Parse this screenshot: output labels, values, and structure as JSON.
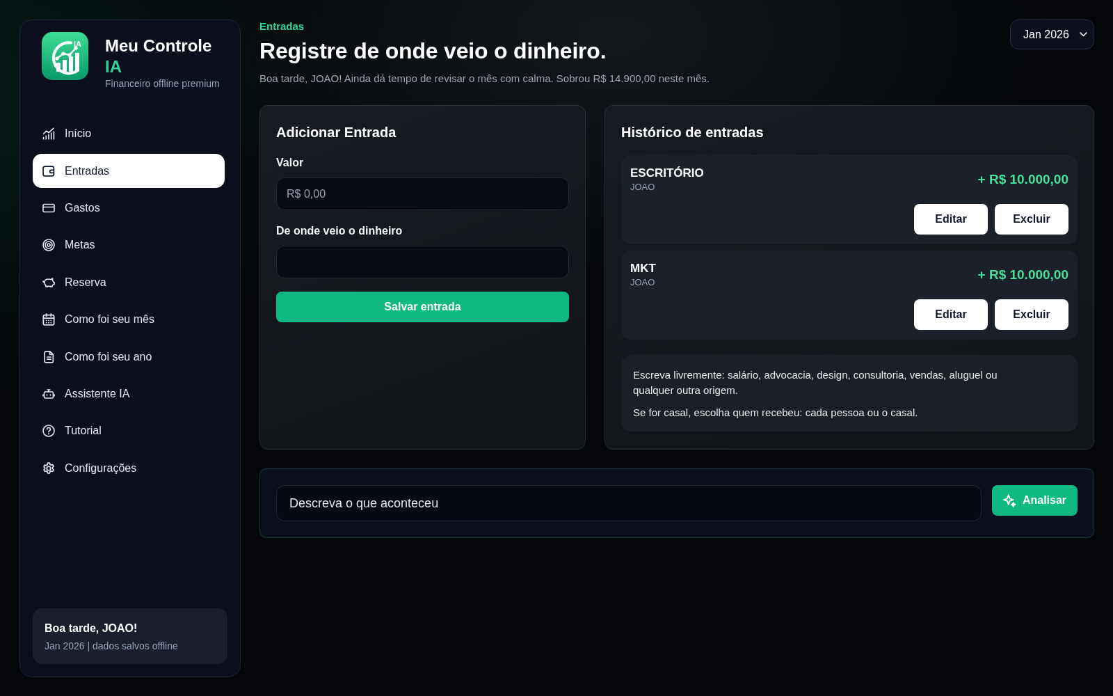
{
  "sidebar": {
    "brand": {
      "logo_text": "IA",
      "title": "Meu Controle",
      "title_accent": "IA",
      "subtitle": "Financeiro offline premium"
    },
    "items": [
      {
        "label": "Início",
        "selected": false
      },
      {
        "label": "Entradas",
        "selected": true
      },
      {
        "label": "Gastos",
        "selected": false
      },
      {
        "label": "Metas",
        "selected": false
      },
      {
        "label": "Reserva",
        "selected": false
      },
      {
        "label": "Como foi seu mês",
        "selected": false
      },
      {
        "label": "Como foi seu ano",
        "selected": false
      },
      {
        "label": "Assistente IA",
        "selected": false
      },
      {
        "label": "Tutorial",
        "selected": false
      },
      {
        "label": "Configurações",
        "selected": false
      }
    ],
    "footer": {
      "title": "Boa tarde, JOAO!",
      "subtitle": "Jan 2026 | dados salvos offline"
    }
  },
  "header": {
    "eyebrow": "Entradas",
    "title": "Registre de onde veio o dinheiro.",
    "subtitle": "Boa tarde, JOAO! Ainda dá tempo de revisar o mês com calma. Sobrou R$ 14.900,00 neste mês.",
    "month_select": {
      "value": "Jan 2026"
    }
  },
  "add_form": {
    "title": "Adicionar Entrada",
    "fields": [
      {
        "label": "Valor",
        "placeholder": "R$ 0,00"
      },
      {
        "label": "De onde veio o dinheiro"
      }
    ],
    "submit": "Salvar entrada"
  },
  "history": {
    "title": "Histórico de entradas",
    "entries": [
      {
        "source": "ESCRITÓRIO",
        "person": "JOAO",
        "amount": "+ R$ 10.000,00",
        "actions": [
          "Editar",
          "Excluir"
        ]
      },
      {
        "source": "MKT",
        "person": "JOAO",
        "amount": "+ R$ 10.000,00",
        "actions": [
          "Editar",
          "Excluir"
        ]
      }
    ],
    "notes": [
      "Escreva livremente: salário, advocacia, design, consultoria, vendas, aluguel ou qualquer outra origem.",
      "Se for casal, escolha quem recebeu: cada pessoa ou o casal."
    ]
  },
  "assistant_bar": {
    "placeholder": "Descreva o que aconteceu",
    "button": "Analisar"
  }
}
